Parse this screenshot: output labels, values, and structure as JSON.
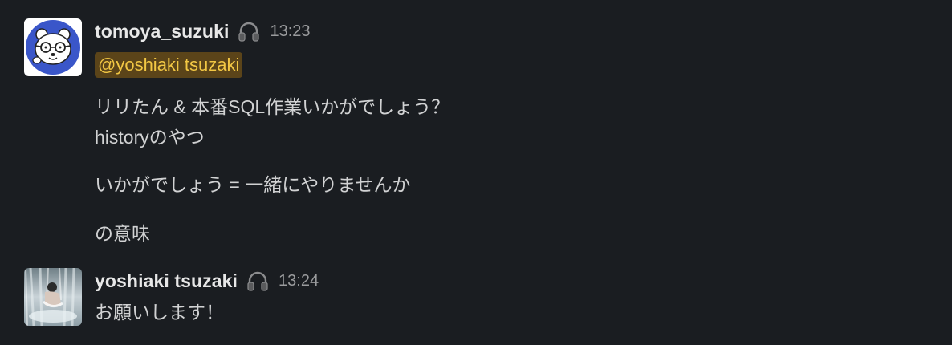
{
  "messages": [
    {
      "username": "tomoya_suzuki",
      "status_icon": "headphones-icon",
      "timestamp": "13:23",
      "mention": "@yoshiaki tsuzaki",
      "lines": [
        "リリたん & 本番SQL作業いかがでしょう？",
        "historyのやつ",
        "いかがでしょう = 一緒にやりませんか",
        "の意味"
      ]
    },
    {
      "username": "yoshiaki tsuzaki",
      "status_icon": "headphones-icon",
      "timestamp": "13:24",
      "lines": [
        "お願いします！"
      ]
    }
  ],
  "colors": {
    "background": "#1a1d21",
    "text": "#d1d2d3",
    "mention_bg": "#5b4419",
    "mention_text": "#f2c744",
    "timestamp": "#9a9b9d"
  }
}
